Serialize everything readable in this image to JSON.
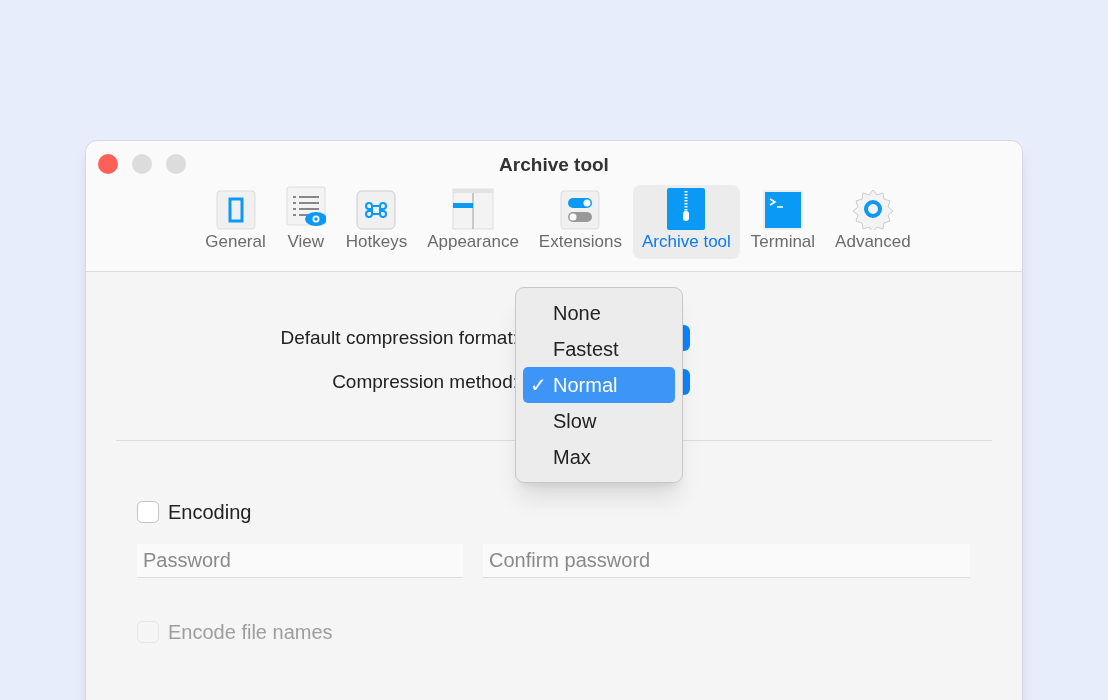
{
  "window": {
    "title": "Archive tool"
  },
  "toolbar": {
    "tabs": [
      {
        "label": "General",
        "selected": false
      },
      {
        "label": "View",
        "selected": false
      },
      {
        "label": "Hotkeys",
        "selected": false
      },
      {
        "label": "Appearance",
        "selected": false
      },
      {
        "label": "Extensions",
        "selected": false
      },
      {
        "label": "Archive tool",
        "selected": true
      },
      {
        "label": "Terminal",
        "selected": false
      },
      {
        "label": "Advanced",
        "selected": false
      }
    ]
  },
  "form": {
    "rows": [
      {
        "label": "Default compression format:"
      },
      {
        "label": "Compression method:"
      }
    ]
  },
  "popup_menu": {
    "items": [
      {
        "label": "None",
        "selected": false
      },
      {
        "label": "Fastest",
        "selected": false
      },
      {
        "label": "Normal",
        "selected": true
      },
      {
        "label": "Slow",
        "selected": false
      },
      {
        "label": "Max",
        "selected": false
      }
    ],
    "check_mark": "✓"
  },
  "encoding": {
    "label": "Encoding",
    "checked": false
  },
  "fields": [
    {
      "placeholder": "Password"
    },
    {
      "placeholder": "Confirm password"
    }
  ],
  "encode_file_names": {
    "label": "Encode file names",
    "checked": false,
    "disabled": true
  }
}
